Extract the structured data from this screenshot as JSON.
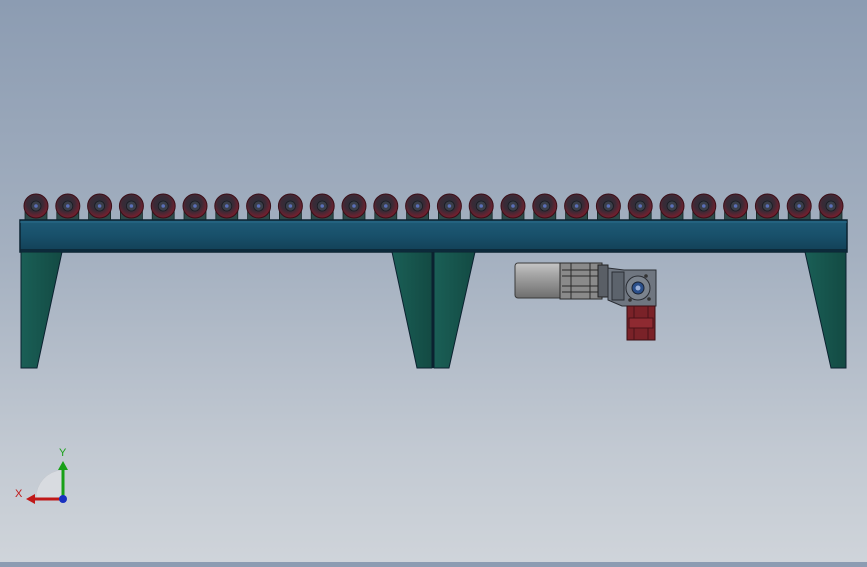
{
  "scene": {
    "subject": "roller-conveyor-with-gear-motor",
    "roller_count": 26,
    "leg_count": 4,
    "colors": {
      "background_top": "#8c9cb2",
      "background_bottom": "#cfd4da",
      "frame": "#1a4d66",
      "frame_edge": "#0b2230",
      "legs": "#18574f",
      "roller": "#7a1f2e",
      "roller_bracket": "#2d4a4a",
      "motor_body": "#9a9a9a",
      "gearbox": "#6f7680",
      "flange": "#7a2228"
    }
  },
  "triad": {
    "x_label": "X",
    "y_label": "Y",
    "x_color": "#c01818",
    "y_color": "#18a018",
    "z_color": "#1830c0"
  }
}
